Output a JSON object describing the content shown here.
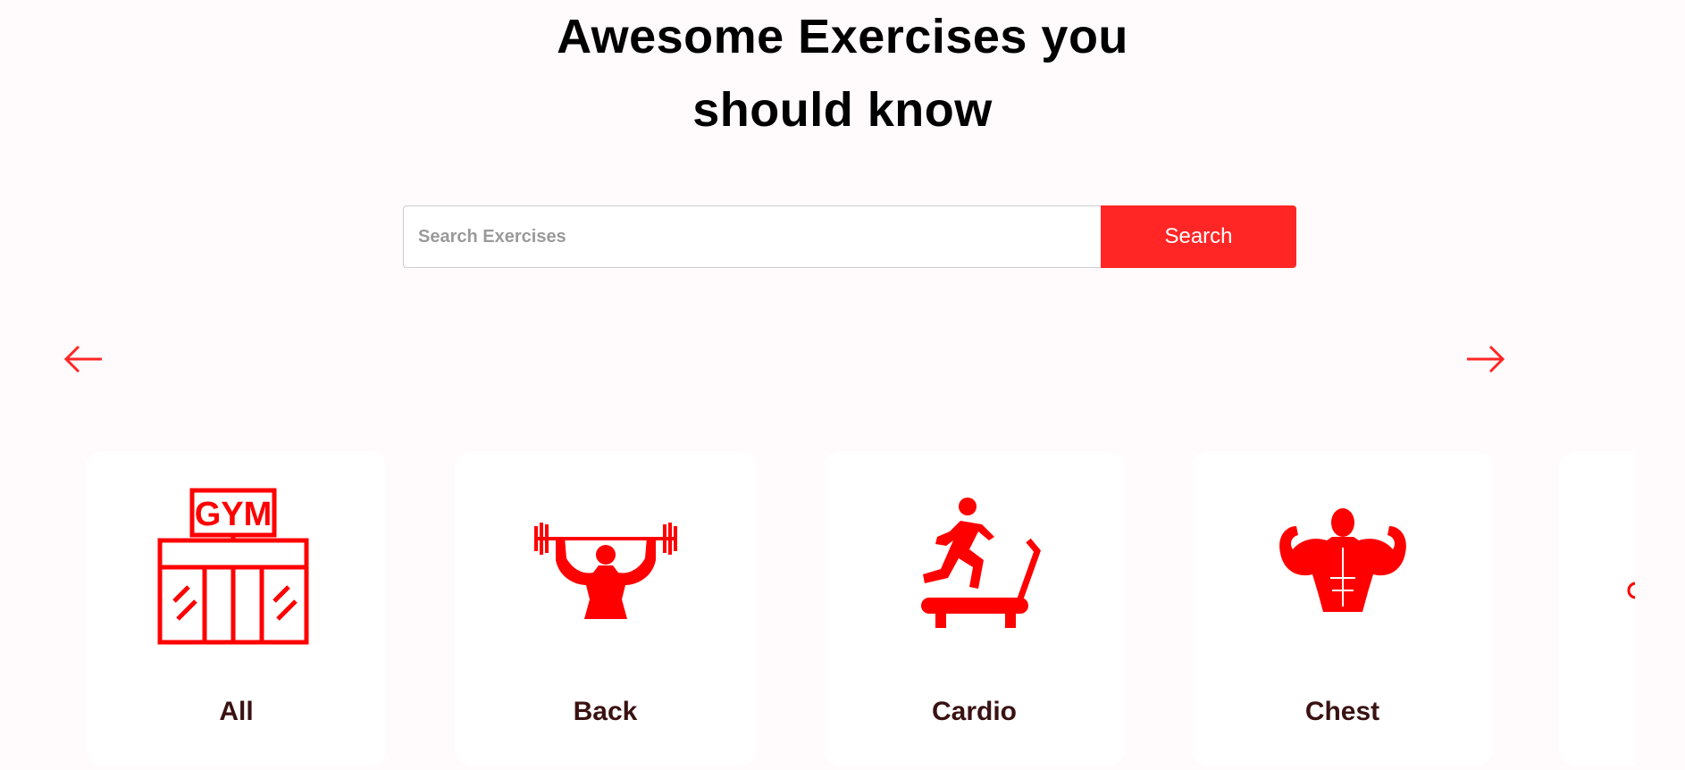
{
  "heading": {
    "line1": "Awesome Exercises you",
    "line2": "should know"
  },
  "search": {
    "placeholder": "Search Exercises",
    "value": "",
    "button_label": "Search"
  },
  "carousel": {
    "prev_icon": "arrow-left-icon",
    "next_icon": "arrow-right-icon",
    "accent_color": "#ff2625",
    "items": [
      {
        "label": "All",
        "icon": "gym-building-icon"
      },
      {
        "label": "Back",
        "icon": "weightlifter-icon"
      },
      {
        "label": "Cardio",
        "icon": "treadmill-runner-icon"
      },
      {
        "label": "Chest",
        "icon": "bodybuilder-flex-icon"
      },
      {
        "label": "",
        "icon": "partial-body-part-icon"
      }
    ]
  }
}
